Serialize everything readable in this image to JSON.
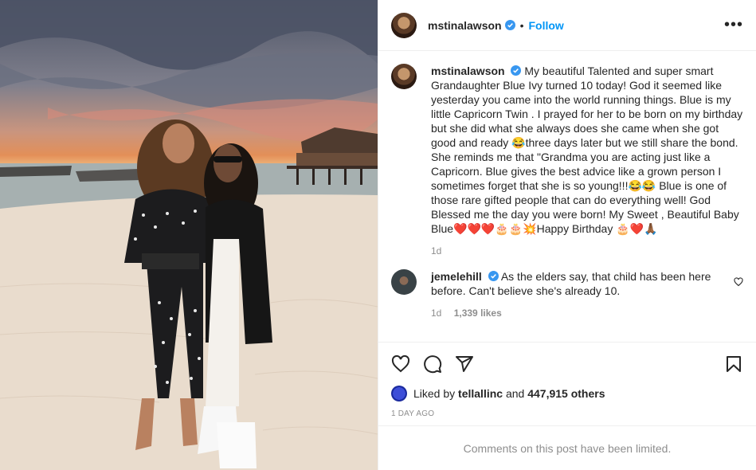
{
  "post": {
    "username": "mstinalawson",
    "follow_label": "Follow",
    "separator": "•",
    "more_label": "•••"
  },
  "caption": {
    "username": "mstinalawson",
    "text": "My beautiful Talented and super smart Grandaughter Blue Ivy turned 10 today! God it seemed like yesterday you came into the world running things. Blue is my little Capricorn Twin . I prayed for her to be born on my birthday but she did what she always does she came when she got good and ready 😂three days later but we still share the bond. She reminds me that \"Grandma you are acting just like a Capricorn. Blue gives the best advice like a grown person I sometimes forget that she is so young!!!😂😂 Blue is one of those rare gifted people that can do everything well! God Blessed me the day you were born! My Sweet , Beautiful Baby Blue❤️❤️❤️🎂🎂💥Happy Birthday 🎂❤️🙏🏾",
    "age": "1d"
  },
  "top_comment": {
    "username": "jemelehill",
    "text": "As the elders say, that child has been here before. Can't believe she's already 10.",
    "age": "1d",
    "likes": "1,339 likes"
  },
  "likes_line": {
    "prefix": "Liked by",
    "user": "tellallinc",
    "middle": "and",
    "count": "447,915 others"
  },
  "posted_date": "1 DAY AGO",
  "comments_limited": "Comments on this post have been limited.",
  "colors": {
    "accent": "#0095f6",
    "verified": "#3897f0",
    "text": "#262626",
    "muted": "#8e8e8e"
  },
  "icons": [
    "verified-badge-icon",
    "more-options-icon",
    "heart-icon",
    "comment-icon",
    "share-icon",
    "bookmark-icon"
  ]
}
